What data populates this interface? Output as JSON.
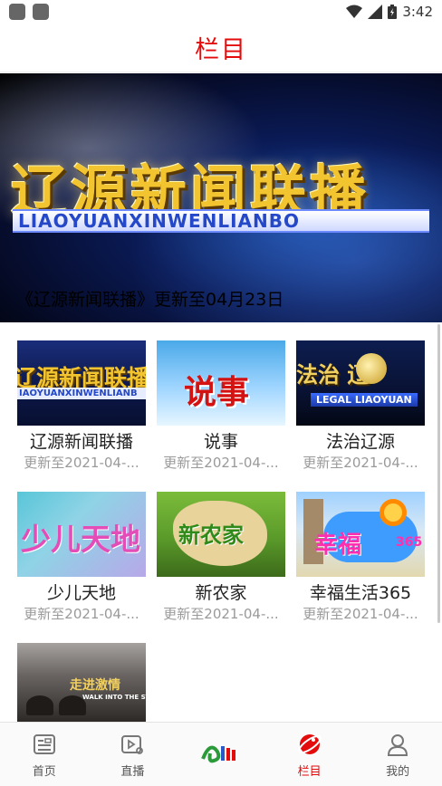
{
  "status_bar": {
    "time": "3:42"
  },
  "header": {
    "title": "栏目"
  },
  "banner": {
    "logo_text": "辽源新闻联播",
    "pinyin": "LIAOYUANXINWENLIANBO",
    "caption": "《辽源新闻联播》更新至04月23日"
  },
  "programs": [
    {
      "title": "辽源新闻联播",
      "updated": "更新至2021-04-...",
      "thumb_text": "辽源新闻联播",
      "thumb_sub": "IAOYUANXINWENLIANB"
    },
    {
      "title": "说事",
      "updated": "更新至2021-04-...",
      "thumb_text": "说事"
    },
    {
      "title": "法治辽源",
      "updated": "更新至2021-04-...",
      "thumb_text": "法治 辽",
      "thumb_sub": "LEGAL LIAOYUAN"
    },
    {
      "title": "少儿天地",
      "updated": "更新至2021-04-...",
      "thumb_text": "少儿天地"
    },
    {
      "title": "新农家",
      "updated": "更新至2021-04-...",
      "thumb_text": "新农家"
    },
    {
      "title": "幸福生活365",
      "updated": "更新至2021-04-...",
      "thumb_text": "幸福",
      "thumb_num": "365"
    },
    {
      "thumb_text": "走进激情",
      "thumb_sub": "WALK INTO THE ST"
    }
  ],
  "tabbar": {
    "items": [
      {
        "label": "首页",
        "icon": "news-icon"
      },
      {
        "label": "直播",
        "icon": "live-play-icon"
      },
      {
        "label": "",
        "icon": "station-logo-icon"
      },
      {
        "label": "栏目",
        "icon": "planet-icon",
        "active": true
      },
      {
        "label": "我的",
        "icon": "user-icon"
      }
    ]
  },
  "colors": {
    "accent": "#e30b0b"
  }
}
